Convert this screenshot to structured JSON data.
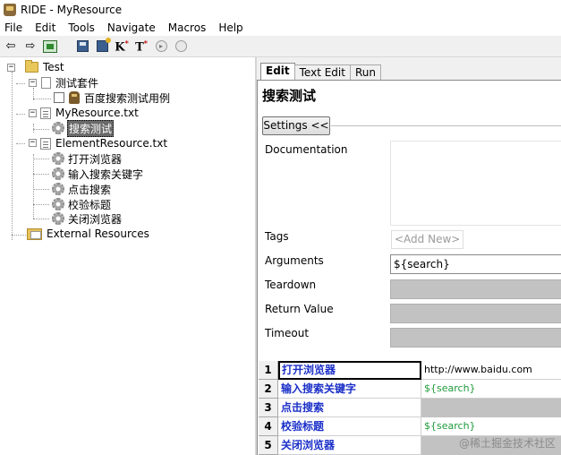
{
  "window": {
    "title": "RIDE - MyResource"
  },
  "menu": [
    "File",
    "Edit",
    "Tools",
    "Navigate",
    "Macros",
    "Help"
  ],
  "toolbar": {
    "back_icon": "⇦",
    "forward_icon": "⇨",
    "kw_k": "K",
    "kw_t": "T"
  },
  "tree": {
    "root": "Test",
    "suite": "测试套件",
    "testcase": "百度搜索测试用例",
    "resource1": "MyResource.txt",
    "resource1_keyword": "搜索测试",
    "resource2": "ElementResource.txt",
    "resource2_keywords": [
      "打开浏览器",
      "输入搜索关键字",
      "点击搜索",
      "校验标题",
      "关闭浏览器"
    ],
    "external": "External Resources"
  },
  "tabs": [
    "Edit",
    "Text Edit",
    "Run"
  ],
  "editor": {
    "title": "搜索测试",
    "settings_label": "Settings <<",
    "labels": {
      "documentation": "Documentation",
      "tags": "Tags",
      "arguments": "Arguments",
      "teardown": "Teardown",
      "return_value": "Return Value",
      "timeout": "Timeout"
    },
    "tags_placeholder": "<Add New>",
    "arguments_value": "${search}"
  },
  "grid": {
    "rows": [
      {
        "num": "1",
        "keyword": "打开浏览器",
        "arg": "http://www.baidu.com"
      },
      {
        "num": "2",
        "keyword": "输入搜索关键字",
        "arg": "${search}"
      },
      {
        "num": "3",
        "keyword": "点击搜索",
        "arg": ""
      },
      {
        "num": "4",
        "keyword": "校验标题",
        "arg": "${search}"
      },
      {
        "num": "5",
        "keyword": "关闭浏览器",
        "arg": ""
      }
    ]
  },
  "watermark": "@稀土掘金技术社区"
}
